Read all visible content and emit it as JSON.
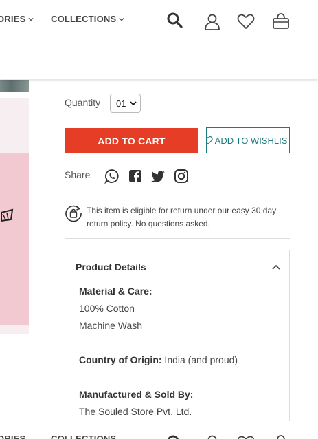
{
  "header": {
    "nav": [
      {
        "label": "ORIES"
      },
      {
        "label": "COLLECTIONS"
      }
    ],
    "icons": [
      "search-icon",
      "user-icon",
      "heart-icon",
      "bag-icon"
    ]
  },
  "product": {
    "quantity_label": "Quantity",
    "quantity_value": "01",
    "add_to_cart": "ADD TO CART",
    "add_to_wishlist": "ADD TO WISHLIST",
    "share_label": "Share",
    "share_icons": [
      "whatsapp-icon",
      "facebook-icon",
      "twitter-icon",
      "instagram-icon"
    ],
    "return_text": "This item is eligible for return under our easy 30 day return policy. No questions asked."
  },
  "details": {
    "title": "Product Details",
    "material_heading": "Material & Care:",
    "material_1": "100% Cotton",
    "material_2": "Machine Wash",
    "origin_label": "Country of Origin:",
    "origin_value": " India (and proud)",
    "manufacturer_heading": "Manufactured & Sold By:",
    "manufacturer_value": "The Souled Store Pvt. Ltd."
  },
  "footer_peek": {
    "nav": [
      {
        "label": "ORIES"
      },
      {
        "label": "COLLECTIONS"
      }
    ]
  },
  "colors": {
    "accent": "#e63d26",
    "wishlist": "#1f7c7c"
  }
}
